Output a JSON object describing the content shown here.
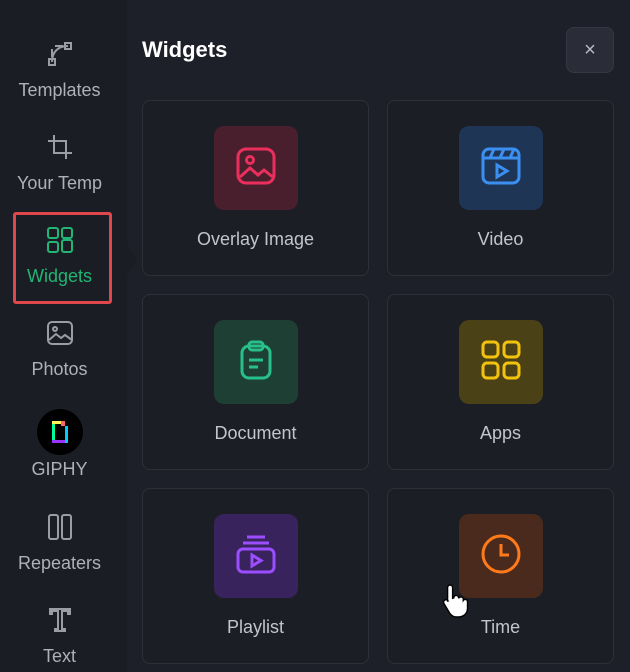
{
  "sidebar": {
    "items": [
      {
        "label": "Templates",
        "icon": "templates-icon"
      },
      {
        "label": "Your Temp",
        "icon": "crop-icon"
      },
      {
        "label": "Widgets",
        "icon": "widgets-icon",
        "active": true
      },
      {
        "label": "Photos",
        "icon": "photo-icon"
      },
      {
        "label": "GIPHY",
        "icon": "giphy-icon"
      },
      {
        "label": "Repeaters",
        "icon": "repeaters-icon"
      },
      {
        "label": "Text",
        "icon": "text-icon"
      }
    ],
    "active_color": "#22b573",
    "highlight_color": "#e0474c"
  },
  "panel": {
    "title": "Widgets",
    "close_label": "×",
    "cards": [
      {
        "label": "Overlay Image",
        "icon": "image-icon",
        "color": "#ea2f5d",
        "bg": "#4a1f2d"
      },
      {
        "label": "Video",
        "icon": "video-icon",
        "color": "#3b8ff0",
        "bg": "#1f3556"
      },
      {
        "label": "Document",
        "icon": "clipboard-icon",
        "color": "#28c08a",
        "bg": "#1e3f34"
      },
      {
        "label": "Apps",
        "icon": "apps-grid-icon",
        "color": "#f2c20e",
        "bg": "#4a4116"
      },
      {
        "label": "Playlist",
        "icon": "playlist-icon",
        "color": "#9b4dff",
        "bg": "#38235c"
      },
      {
        "label": "Time",
        "icon": "clock-icon",
        "color": "#ff7a1a",
        "bg": "#4a2a1c"
      }
    ]
  }
}
